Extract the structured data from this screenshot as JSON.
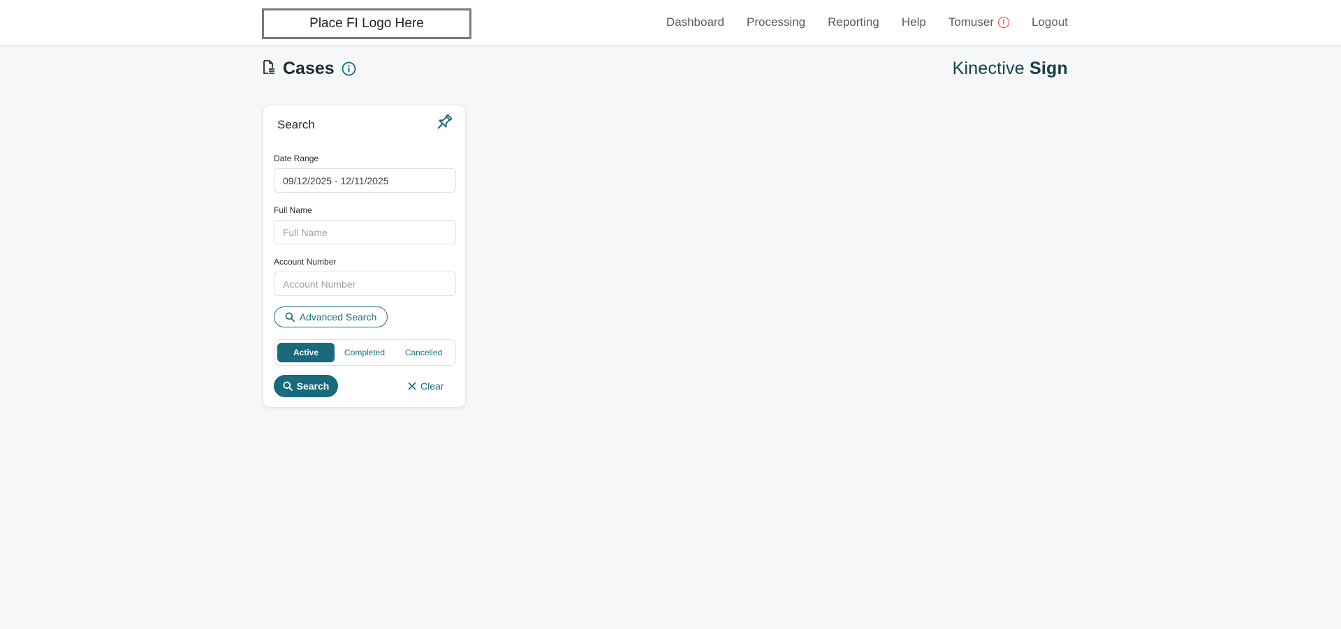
{
  "header": {
    "logo_text": "Place FI Logo Here",
    "nav": {
      "dashboard": "Dashboard",
      "processing": "Processing",
      "reporting": "Reporting",
      "help": "Help",
      "user": "Tomuser",
      "logout": "Logout"
    },
    "user_alert_icon": "exclamation-circle-icon"
  },
  "page": {
    "title": "Cases",
    "title_icon": "document-list-icon",
    "info_icon": "info-circle-icon",
    "brand_light": "Kinective ",
    "brand_bold": "Sign"
  },
  "search_panel": {
    "title": "Search",
    "pin_icon": "pin-icon",
    "date_range_label": "Date Range",
    "date_range_value": "09/12/2025 - 12/11/2025",
    "full_name_label": "Full Name",
    "full_name_placeholder": "Full Name",
    "account_number_label": "Account Number",
    "account_number_placeholder": "Account Number",
    "advanced_search_label": "Advanced Search",
    "status_options": [
      "Active",
      "Completed",
      "Cancelled"
    ],
    "status_selected": "Active",
    "search_button_label": "Search",
    "clear_button_label": "Clear"
  },
  "colors": {
    "accent": "#186a7c",
    "brand_text": "#12414a",
    "alert": "#e53935",
    "page_background": "#f5f7f9"
  }
}
